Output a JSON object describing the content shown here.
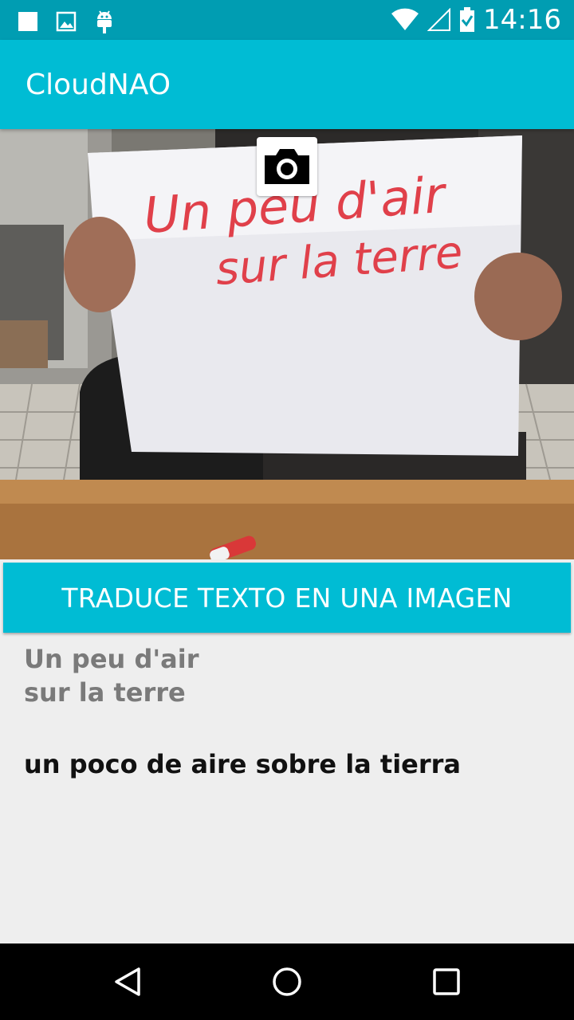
{
  "status_bar": {
    "time": "14:16",
    "icons": [
      "notification-square-icon",
      "image-icon",
      "android-icon",
      "wifi-icon",
      "signal-icon",
      "battery-icon"
    ]
  },
  "app_bar": {
    "title": "CloudNAO"
  },
  "photo": {
    "sign_line_1": "Un peu d'air",
    "sign_line_2": "sur la terre"
  },
  "camera_button": {
    "icon": "camera-icon"
  },
  "translate_button": {
    "label": "TRADUCE TEXTO EN UNA IMAGEN"
  },
  "result": {
    "source_line_1": "Un peu d'air",
    "source_line_2": "sur la terre",
    "translation": "un poco de aire sobre la tierra"
  },
  "nav_bar": {
    "icons": [
      "back-icon",
      "home-icon",
      "recents-icon"
    ]
  },
  "colors": {
    "status_bar": "#009db2",
    "primary": "#00bcd4",
    "background": "#eeeeee",
    "source_text": "#7a7a7a",
    "translation_text": "#111111",
    "sign_ink": "#e0404a"
  }
}
